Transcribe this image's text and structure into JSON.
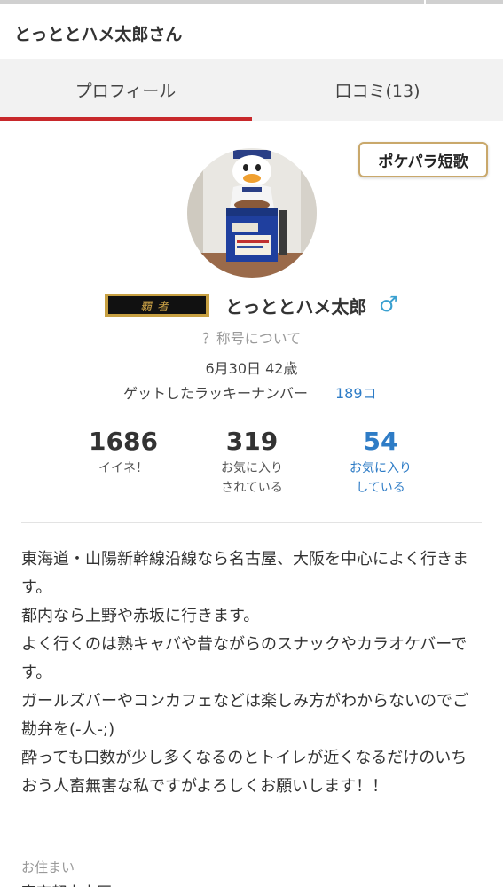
{
  "header": {
    "title": "とっととハメ太郎さん"
  },
  "tabs": [
    {
      "label": "プロフィール",
      "active": true
    },
    {
      "label": "口コミ(13)",
      "active": false
    }
  ],
  "badge": {
    "label": "ポケパラ短歌"
  },
  "profile": {
    "title_plate": "覇者",
    "name": "とっととハメ太郎",
    "gender_icon": "male-icon",
    "title_help": "？称号について",
    "birth": "6月30日 42歳",
    "lucky_label": "ゲットしたラッキーナンバー",
    "lucky_value": "189コ"
  },
  "stats": [
    {
      "value": "1686",
      "label": "イイネ！"
    },
    {
      "value": "319",
      "label": "お気に入り\nされている"
    },
    {
      "value": "54",
      "label": "お気に入り\nしている"
    }
  ],
  "bio": "東海道・山陽新幹線沿線なら名古屋、大阪を中心によく行きます。\n都内なら上野や赤坂に行きます。\nよく行くのは熟キャバや昔ながらのスナックやカラオケバーです。\nガールズバーやコンカフェなどは楽しみ方がわからないのでご勘弁を(-人-;)\n酔っても口数が少し多くなるのとトイレが近くなるだけのいちおう人畜無害な私ですがよろしくお願いします！！",
  "residence": {
    "label": "お住まい",
    "value": "東京都中央区"
  },
  "colors": {
    "accent": "#c8282b",
    "link": "#2e7cc6",
    "badge_border": "#c9a86b",
    "plate_gold": "#c7a042"
  }
}
